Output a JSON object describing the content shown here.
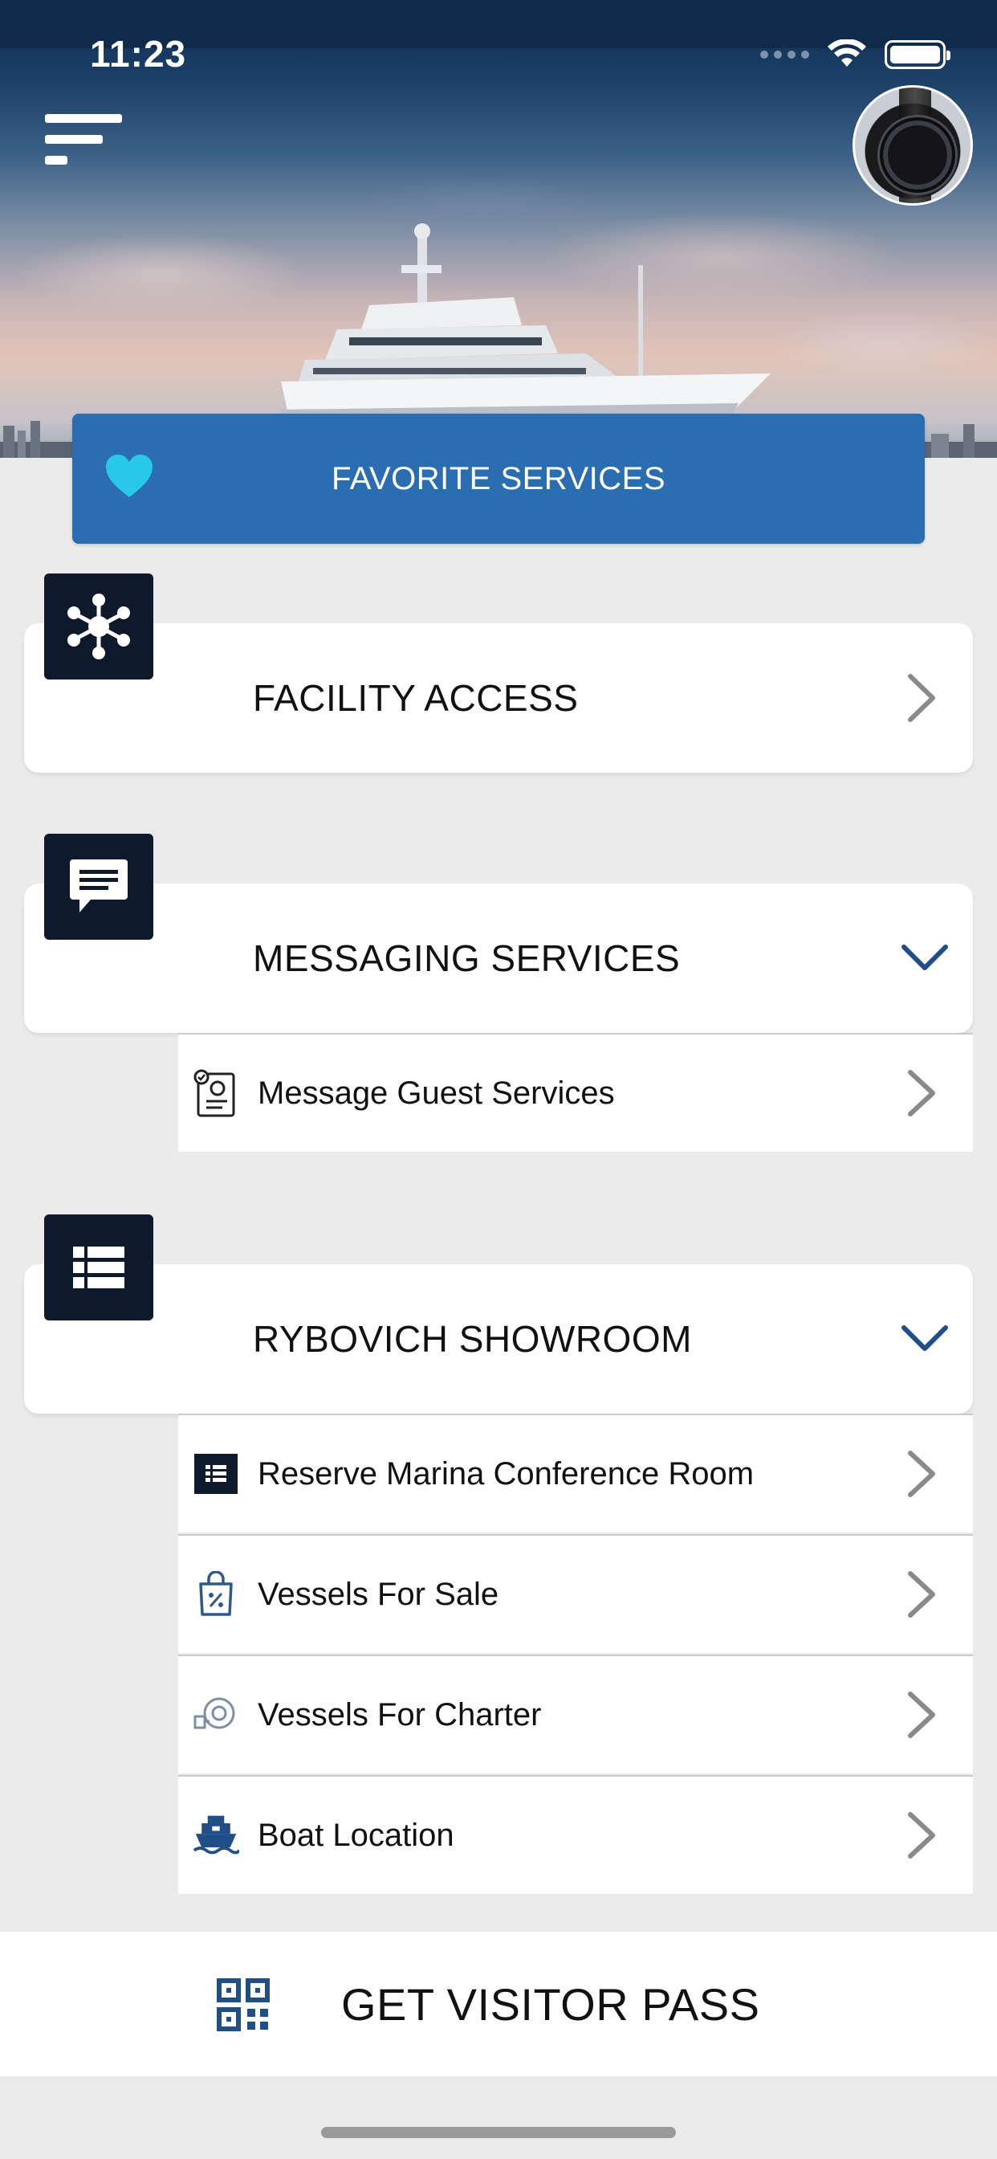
{
  "status_bar": {
    "time": "11:23"
  },
  "favorites": {
    "label": "FAVORITE SERVICES",
    "heart_color": "#28c8e8"
  },
  "sections": [
    {
      "title": "FACILITY ACCESS",
      "icon": "network-hub-icon",
      "expanded": false
    },
    {
      "title": "MESSAGING SERVICES",
      "icon": "chat-bubble-icon",
      "expanded": true,
      "items": [
        {
          "label": "Message Guest Services",
          "icon": "guest-services-icon"
        }
      ]
    },
    {
      "title": "RYBOVICH SHOWROOM",
      "icon": "list-icon",
      "expanded": true,
      "items": [
        {
          "label": "Reserve Marina Conference Room",
          "icon": "list-icon"
        },
        {
          "label": "Vessels For Sale",
          "icon": "sale-bag-icon"
        },
        {
          "label": "Vessels For Charter",
          "icon": "turbo-icon"
        },
        {
          "label": "Boat Location",
          "icon": "boat-icon"
        }
      ]
    }
  ],
  "visitor_pass": {
    "label": "GET VISITOR PASS",
    "icon": "qr-code-icon"
  },
  "colors": {
    "accent": "#2b6db1",
    "badge": "#0e1a2b",
    "chevron_expanded": "#1f4f86",
    "chevron_collapsed": "#8a8a8a"
  }
}
